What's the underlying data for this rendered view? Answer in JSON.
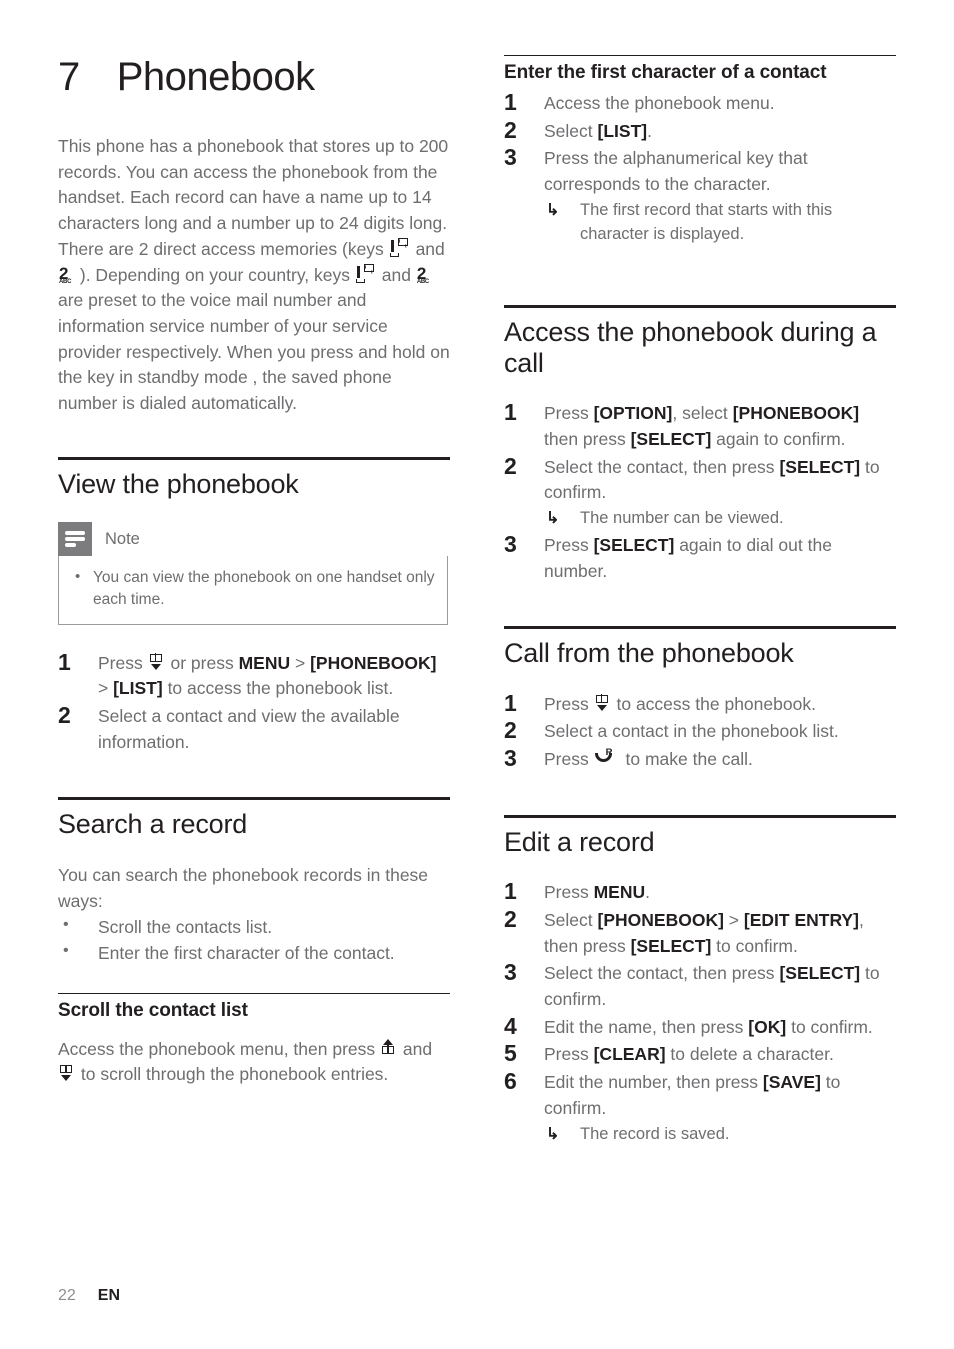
{
  "chapter": {
    "number": "7",
    "title": "Phonebook"
  },
  "intro": {
    "p1": "This phone has a phonebook that stores up to 200 records. You can access the phonebook from the handset. Each record can have a name up to 14 characters long and a number up to 24 digits long.",
    "p2_a": "There are 2 direct access memories (keys",
    "p2_b": "and",
    "p2_c": "). Depending on your country, keys",
    "p2_d": "and",
    "p2_e": "are preset to the voice mail number and information service number of your service provider respectively. When you press and hold on the key in standby mode , the saved phone number is dialed automatically."
  },
  "view_phonebook": {
    "heading": "View the phonebook",
    "note": {
      "label": "Note",
      "items": [
        "You can view the phonebook on one handset only each time."
      ]
    },
    "steps": [
      {
        "num": "1",
        "a": "Press",
        "b": "or press",
        "menu": "MENU",
        "gt1": ">",
        "phonebook": "[PHONEBOOK]",
        "gt2": ">",
        "list": "[LIST]",
        "c": "to access the phonebook list."
      },
      {
        "num": "2",
        "a": "Select a contact and view the available information."
      }
    ]
  },
  "search_record": {
    "heading": "Search a record",
    "intro": "You can search the phonebook records in these ways:",
    "bullets": [
      "Scroll the contacts list.",
      "Enter the first character of the contact."
    ],
    "scroll": {
      "heading": "Scroll the contact list",
      "text_a": "Access the phonebook menu, then press",
      "text_b": "and",
      "text_c": "to scroll through the phonebook entries."
    },
    "first_char": {
      "heading": "Enter the first character of a contact",
      "steps": [
        {
          "num": "1",
          "a": "Access the phonebook menu."
        },
        {
          "num": "2",
          "a": "Select",
          "key": "[LIST]",
          "b": "."
        },
        {
          "num": "3",
          "a": "Press the alphanumerical key that corresponds to the character.",
          "result": "The first record that starts with this character is displayed."
        }
      ]
    }
  },
  "access_during_call": {
    "heading": "Access the phonebook during a call",
    "steps": [
      {
        "num": "1",
        "a": "Press",
        "k1": "[OPTION]",
        "b": ", select",
        "k2": "[PHONEBOOK]",
        "c": "then press",
        "k3": "[SELECT]",
        "d": "again to confirm."
      },
      {
        "num": "2",
        "a": "Select the contact, then press",
        "k1": "[SELECT]",
        "b": "to confirm.",
        "result": "The number can be viewed."
      },
      {
        "num": "3",
        "a": "Press",
        "k1": "[SELECT]",
        "b": "again to dial out the number."
      }
    ]
  },
  "call_from_phonebook": {
    "heading": "Call from the phonebook",
    "steps": [
      {
        "num": "1",
        "a": "Press",
        "b": "to access the phonebook."
      },
      {
        "num": "2",
        "a": "Select a contact in the phonebook list."
      },
      {
        "num": "3",
        "a": "Press",
        "b": "to make the call."
      }
    ]
  },
  "edit_record": {
    "heading": "Edit a record",
    "steps": [
      {
        "num": "1",
        "a": "Press",
        "k1": "MENU",
        "b": "."
      },
      {
        "num": "2",
        "a": "Select",
        "k1": "[PHONEBOOK]",
        "gt": ">",
        "k2": "[EDIT ENTRY]",
        "b": ", then press",
        "k3": "[SELECT]",
        "c": "to confirm."
      },
      {
        "num": "3",
        "a": "Select the contact, then press",
        "k1": "[SELECT]",
        "b": "to confirm."
      },
      {
        "num": "4",
        "a": "Edit the name, then press",
        "k1": "[OK]",
        "b": "to confirm."
      },
      {
        "num": "5",
        "a": "Press",
        "k1": "[CLEAR]",
        "b": "to delete a character."
      },
      {
        "num": "6",
        "a": "Edit the number, then press",
        "k1": "[SAVE]",
        "b": "to confirm.",
        "result": "The record is saved."
      }
    ]
  },
  "footer": {
    "page": "22",
    "language": "EN"
  },
  "icons": {
    "key_one_envelope": "key-1-voicemail-icon",
    "key_two_abc": "key-2-abc-icon",
    "phonebook_down": "phonebook-down-icon",
    "scroll_up": "scroll-up-icon",
    "call_r": "call-key-icon",
    "result_arrow": "↳"
  },
  "colors": {
    "heading": "#231f20",
    "body": "#6d6e70",
    "note_icon_bg": "#7c7c7e",
    "note_border": "#9b9b9d"
  }
}
